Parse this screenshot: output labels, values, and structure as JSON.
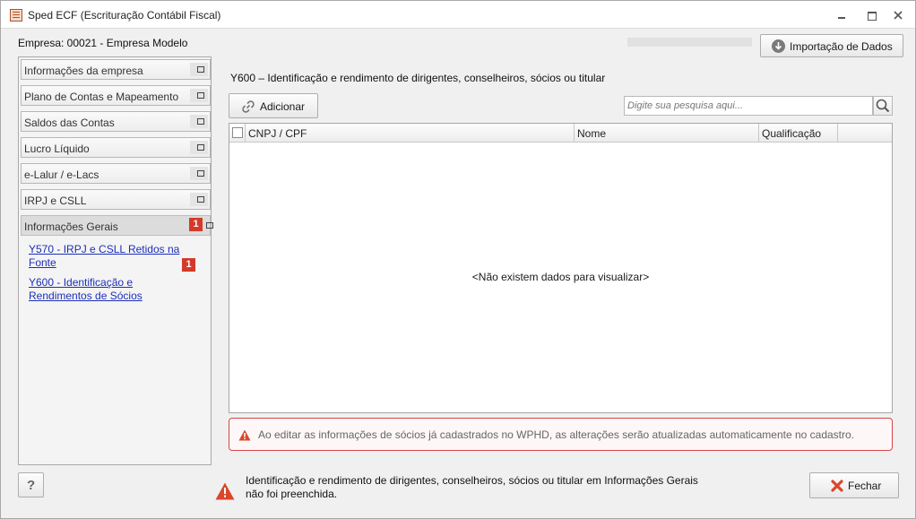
{
  "window": {
    "title": "Sped ECF (Escrituração Contábil Fiscal)"
  },
  "header": {
    "empresa": "Empresa: 00021 - Empresa Modelo",
    "import_button": "Importação de Dados"
  },
  "sidebar": {
    "items": [
      {
        "label": "Informações da empresa"
      },
      {
        "label": "Plano de Contas e Mapeamento"
      },
      {
        "label": "Saldos das Contas"
      },
      {
        "label": "Lucro Líquido"
      },
      {
        "label": "e-Lalur / e-Lacs"
      },
      {
        "label": "IRPJ e CSLL"
      },
      {
        "label": "Informações Gerais",
        "badge": "1"
      }
    ],
    "sub_links": [
      {
        "label": "Y570 - IRPJ e CSLL Retidos na Fonte",
        "badge": "1"
      },
      {
        "label": "Y600 - Identificação e Rendimentos de Sócios"
      }
    ],
    "help_button": "?"
  },
  "main": {
    "section_title": "Y600 – Identificação e rendimento de dirigentes, conselheiros, sócios ou titular",
    "add_button": "Adicionar",
    "search_placeholder": "Digite sua pesquisa aqui...",
    "table": {
      "columns": [
        "CNPJ / CPF",
        "Nome",
        "Qualificação"
      ],
      "empty_message": "<Não existem dados para visualizar>"
    },
    "warning": "Ao editar as informações de sócios já cadastrados no WPHD, as alterações serão atualizadas automaticamente no cadastro."
  },
  "footer": {
    "message": "Identificação e rendimento de dirigentes, conselheiros, sócios ou titular em Informações Gerais não foi preenchida.",
    "close_button": "Fechar"
  },
  "colors": {
    "badge": "#d43a2a",
    "link": "#1d2fb8",
    "warning_border": "#d54848",
    "warning_icon": "#d9472b"
  }
}
